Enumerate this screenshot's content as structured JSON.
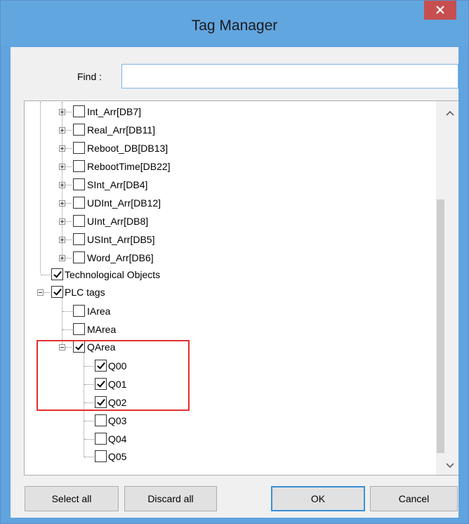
{
  "window": {
    "title": "Tag Manager"
  },
  "find": {
    "label": "Find :",
    "value": ""
  },
  "tree": {
    "nodes": [
      {
        "label": "Int_Arr[DB7]",
        "checked": false,
        "expander": "plus"
      },
      {
        "label": "Real_Arr[DB11]",
        "checked": false,
        "expander": "plus"
      },
      {
        "label": "Reboot_DB[DB13]",
        "checked": false,
        "expander": "plus"
      },
      {
        "label": "RebootTime[DB22]",
        "checked": false,
        "expander": "plus"
      },
      {
        "label": "SInt_Arr[DB4]",
        "checked": false,
        "expander": "plus"
      },
      {
        "label": "UDInt_Arr[DB12]",
        "checked": false,
        "expander": "plus"
      },
      {
        "label": "UInt_Arr[DB8]",
        "checked": false,
        "expander": "plus"
      },
      {
        "label": "USInt_Arr[DB5]",
        "checked": false,
        "expander": "plus"
      },
      {
        "label": "Word_Arr[DB6]",
        "checked": false,
        "expander": "plus"
      },
      {
        "label": "Technological Objects",
        "checked": true,
        "expander": "none"
      },
      {
        "label": "PLC tags",
        "checked": true,
        "expander": "minus"
      },
      {
        "label": "IArea",
        "checked": false,
        "expander": "none"
      },
      {
        "label": "MArea",
        "checked": false,
        "expander": "none"
      },
      {
        "label": "QArea",
        "checked": true,
        "expander": "minus"
      },
      {
        "label": "Q00",
        "checked": true,
        "expander": "none"
      },
      {
        "label": "Q01",
        "checked": true,
        "expander": "none"
      },
      {
        "label": "Q02",
        "checked": true,
        "expander": "none"
      },
      {
        "label": "Q03",
        "checked": false,
        "expander": "none"
      },
      {
        "label": "Q04",
        "checked": false,
        "expander": "none"
      },
      {
        "label": "Q05",
        "checked": false,
        "expander": "none"
      }
    ]
  },
  "buttons": {
    "select_all": "Select all",
    "discard_all": "Discard all",
    "ok": "OK",
    "cancel": "Cancel"
  },
  "colors": {
    "titlebar": "#62a6e0",
    "close": "#c74f4f",
    "highlight": "#e03030"
  }
}
